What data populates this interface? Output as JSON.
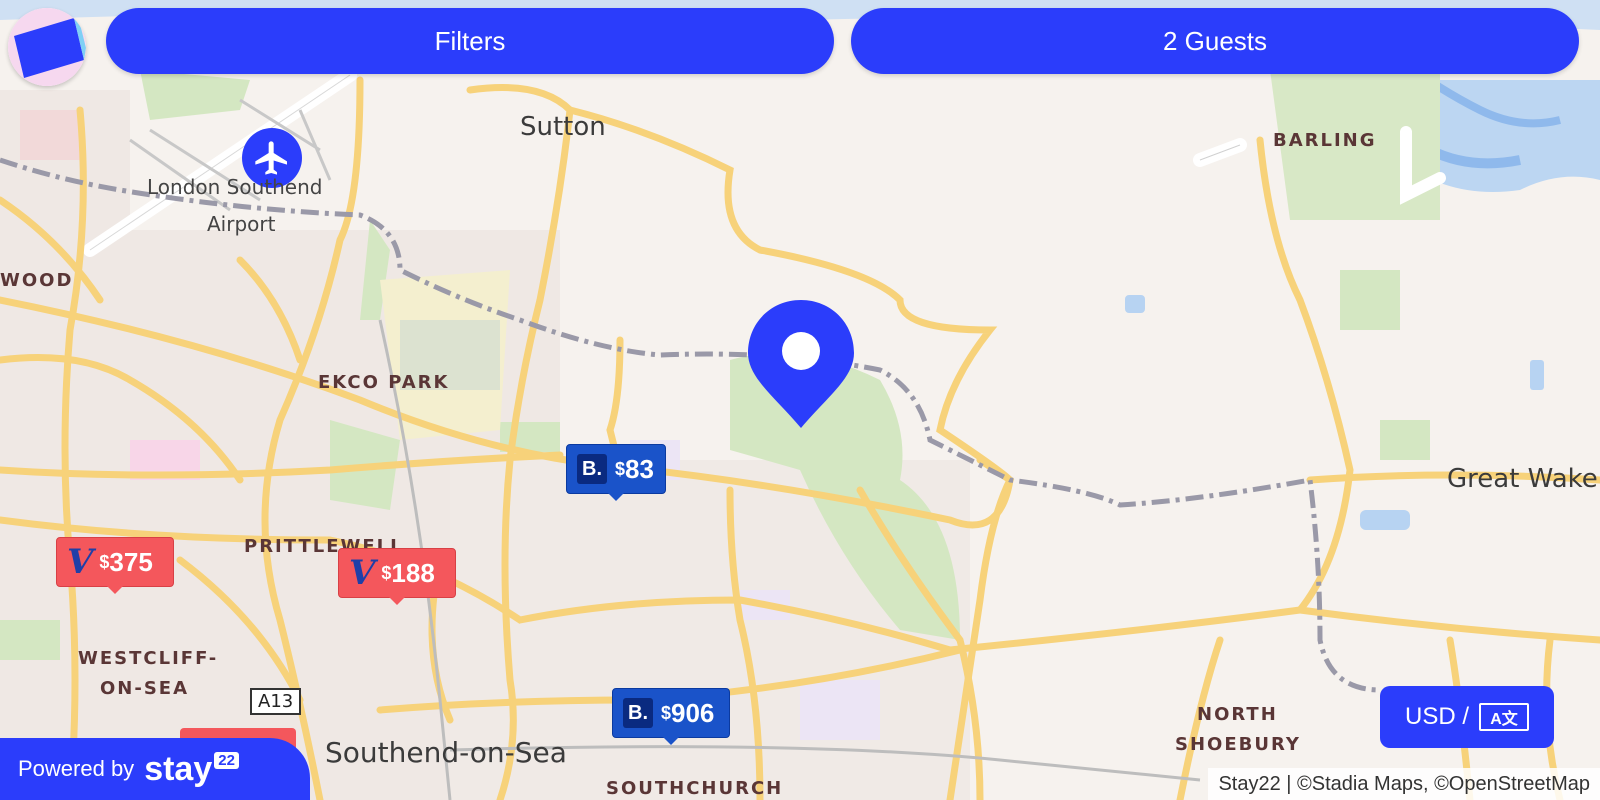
{
  "header": {
    "filters_label": "Filters",
    "guests_label": "2 Guests"
  },
  "places": {
    "sutton": "Sutton",
    "barling": "BARLING",
    "airport_line1": "London Southend",
    "airport_line2": "Airport",
    "wood": "WOOD",
    "ekco_park": "EKCO PARK",
    "great_wake": "Great Wake",
    "prittlewell": "PRITTLEWELL",
    "westcliff_line1": "WESTCLIFF-",
    "westcliff_line2": "ON-SEA",
    "southend": "Southend-on-Sea",
    "southchurch": "SOUTHCHURCH",
    "north_line1": "NORTH",
    "north_line2": "SHOEBURY",
    "a13": "A13"
  },
  "listings": [
    {
      "provider": "booking",
      "logo": "B.",
      "currency": "$",
      "amount": "83"
    },
    {
      "provider": "vrbo",
      "logo": "V",
      "currency": "$",
      "amount": "375"
    },
    {
      "provider": "vrbo",
      "logo": "V",
      "currency": "$",
      "amount": "188"
    },
    {
      "provider": "booking",
      "logo": "B.",
      "currency": "$",
      "amount": "906"
    }
  ],
  "footer": {
    "powered_by": "Powered by",
    "brand": "stay",
    "brand_badge": "22",
    "attribution": "Stay22 | ©Stadia Maps, ©OpenStreetMap"
  },
  "currency_button": {
    "label": "USD /",
    "lang_icon_text": "A文"
  },
  "icons": {
    "airport": "airplane-icon",
    "location_pin": "location-pin-icon",
    "logo": "brand-logo-icon"
  },
  "colors": {
    "accent": "#2b3dfb",
    "booking": "#1a53c9",
    "vrbo": "#f4575c"
  }
}
